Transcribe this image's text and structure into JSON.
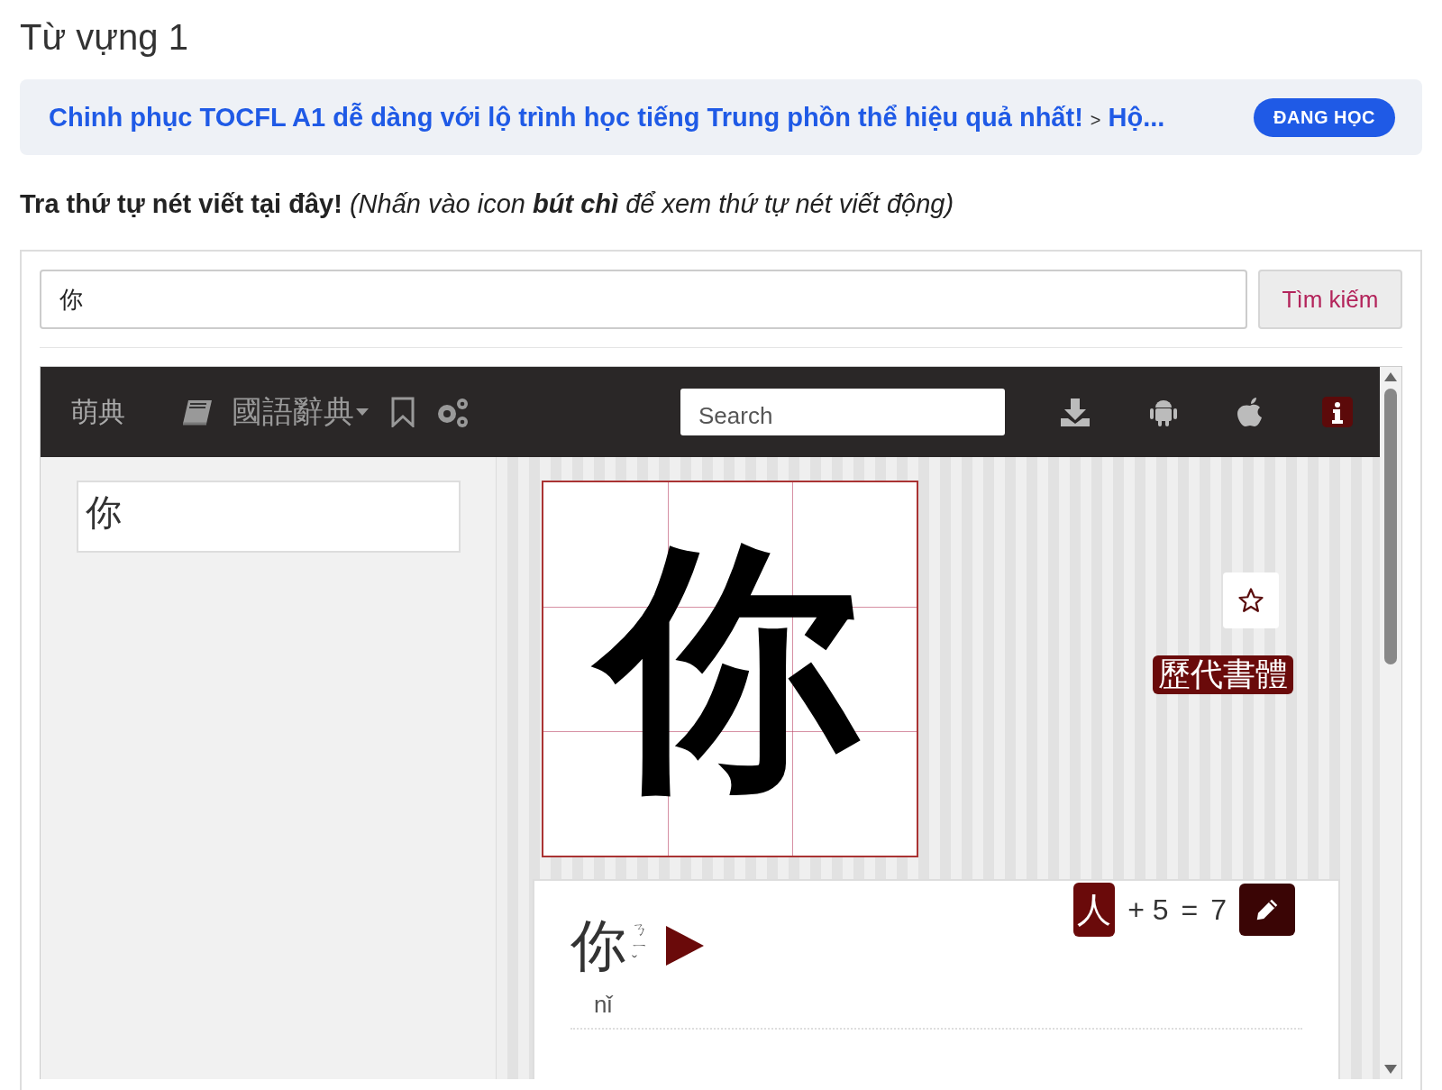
{
  "page_title": "Từ vựng 1",
  "course_banner": {
    "course": "Chinh phục TOCFL A1 dễ dàng với lộ trình học tiếng Trung phồn thể hiệu quả nhất!",
    "separator": ">",
    "lesson": "Hộ...",
    "status": "ĐANG HỌC"
  },
  "instruction": {
    "lead": "Tra thứ tự nét viết tại đây!",
    "hint": "(Nhấn vào icon **bút chì** để xem thứ tự nét viết động)"
  },
  "lookup": {
    "value": "你",
    "button": "Tìm kiếm"
  },
  "dictionary": {
    "logo": "萌典",
    "dictionary_menu": "國語辭典",
    "search": {
      "placeholder": "Search"
    },
    "query": "你",
    "character": "你",
    "starred": false,
    "calligraphy_button": "歷代書體",
    "entry": {
      "word": "你",
      "bopomofo": "ㄋㄧˇ",
      "pinyin": "nǐ",
      "radical": "人",
      "extra_strokes": "+ 5",
      "equals": "=",
      "total_strokes": "7"
    }
  }
}
